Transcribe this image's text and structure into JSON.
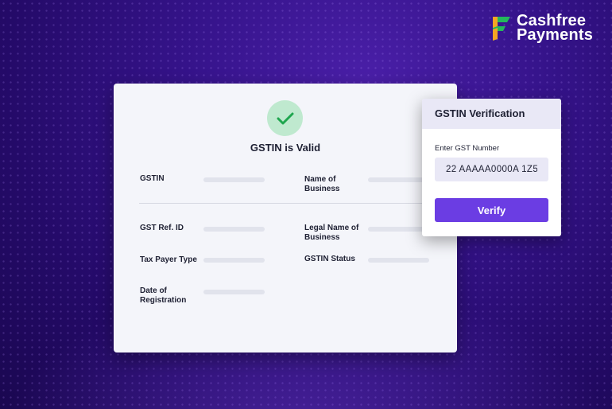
{
  "brand": {
    "line1": "Cashfree",
    "line2": "Payments",
    "logo_icon": "cashfree-logo-icon",
    "colors": {
      "green": "#23b85c",
      "orange": "#f5a623"
    }
  },
  "result": {
    "status_icon": "check-icon",
    "title": "GSTIN is Valid",
    "fields": {
      "gstin": "GSTIN",
      "name_of_business": "Name of Business",
      "gst_ref_id": "GST Ref. ID",
      "legal_name": "Legal Name of Business",
      "tax_payer_type": "Tax Payer Type",
      "gstin_status": "GSTIN Status",
      "date_of_registration": "Date of Registration"
    }
  },
  "verification": {
    "title": "GSTIN Verification",
    "input_label": "Enter GST Number",
    "input_value": "22 AAAAA0000A 1Z5",
    "button_label": "Verify",
    "accent": "#6b3de3"
  }
}
